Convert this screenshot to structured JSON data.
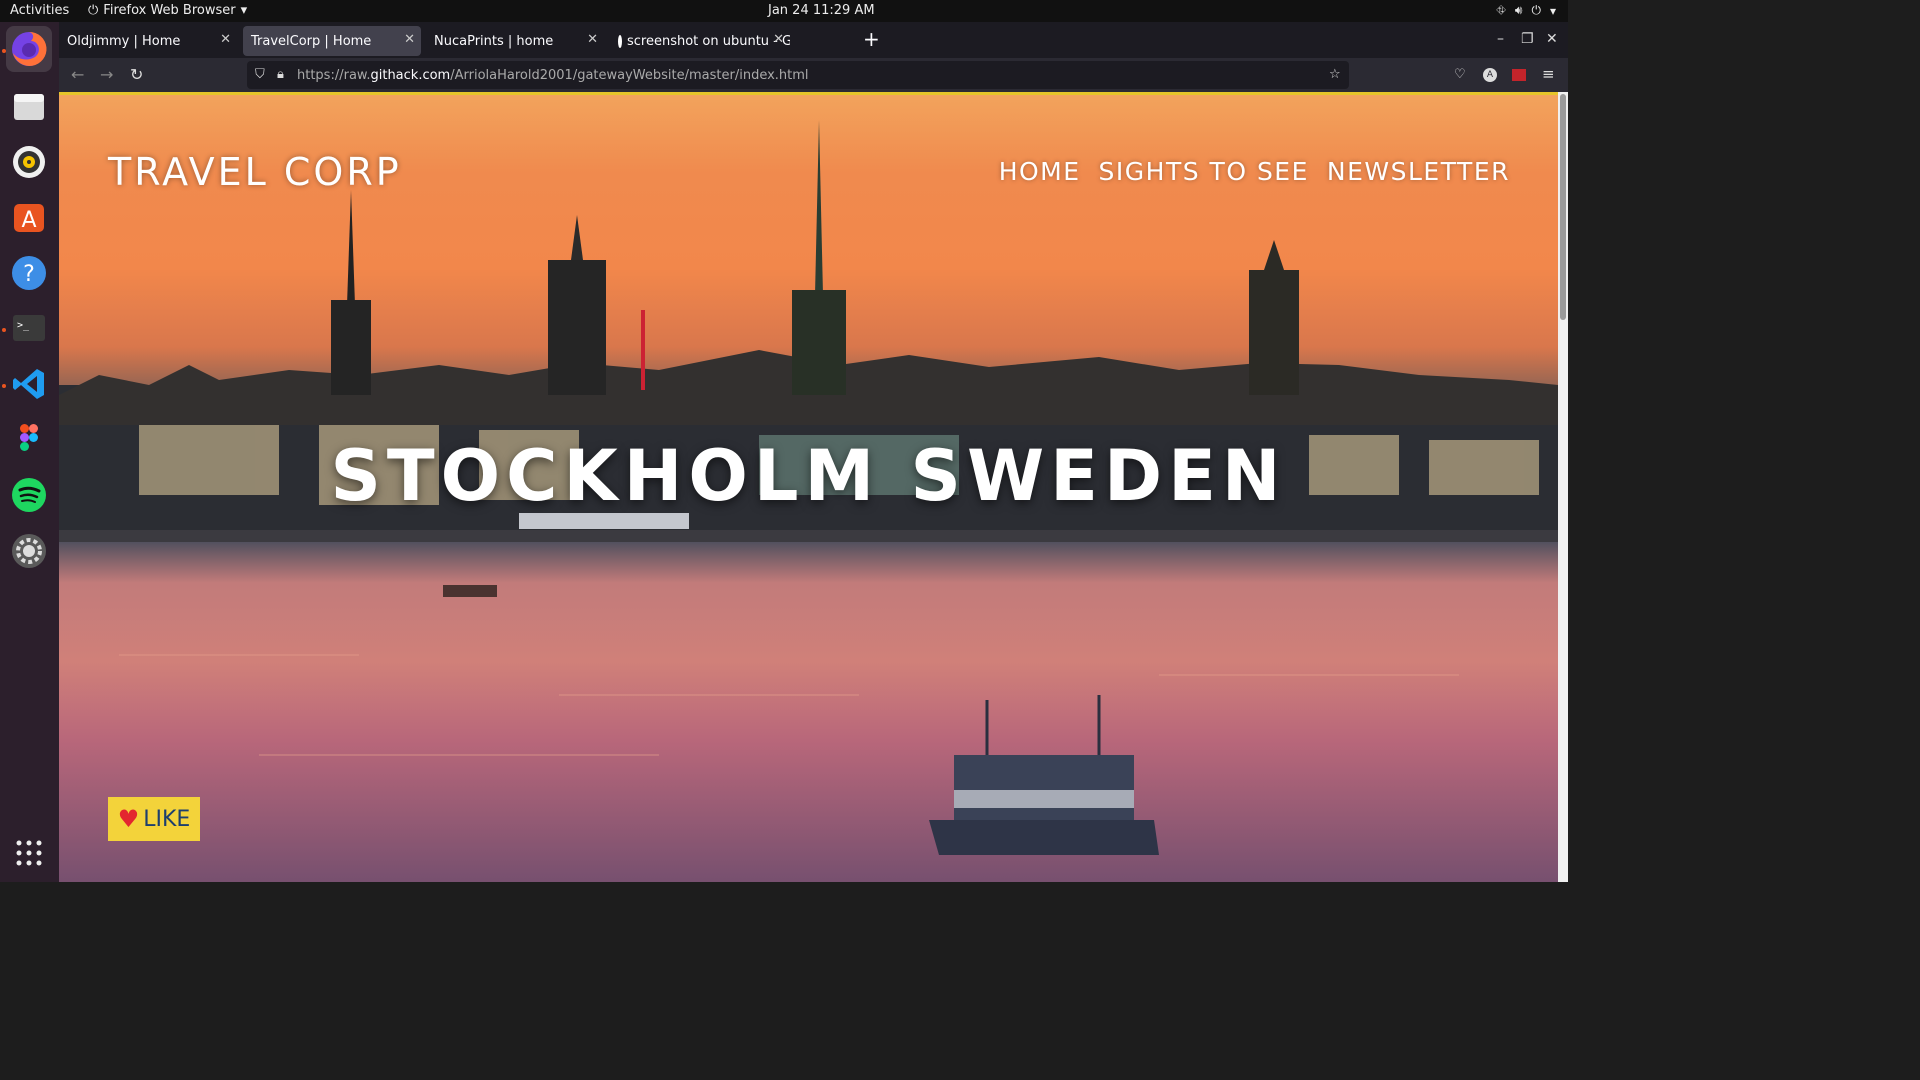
{
  "topbar": {
    "activities": "Activities",
    "app_name": "Firefox Web Browser",
    "clock": "Jan 24  11:29 AM"
  },
  "dock": {
    "items": [
      "firefox",
      "files",
      "rhythmbox",
      "software",
      "help",
      "terminal",
      "vscode",
      "figma",
      "spotify",
      "settings",
      "app-grid"
    ]
  },
  "browser": {
    "tabs": [
      {
        "label": "Oldjimmy | Home",
        "selected": false
      },
      {
        "label": "TravelCorp | Home",
        "selected": true
      },
      {
        "label": "NucaPrints | home",
        "selected": false
      },
      {
        "label": "screenshot on ubuntu - G",
        "selected": false
      }
    ],
    "url": {
      "prefix": "https://raw.",
      "domain": "githack.com",
      "path": "/ArriolaHarold2001/gatewayWebsite/master/index.html"
    }
  },
  "page": {
    "brand": "TRAVEL CORP",
    "nav": [
      "HOME",
      "SIGHTS TO SEE",
      "NEWSLETTER"
    ],
    "hero_title": "STOCKHOLM SWEDEN",
    "like_label": "LIKE"
  },
  "colors": {
    "accent_bar": "#e6c42a",
    "like_bg": "#f3d33a",
    "like_text": "#1d3f6e",
    "heart": "#e3262f"
  }
}
